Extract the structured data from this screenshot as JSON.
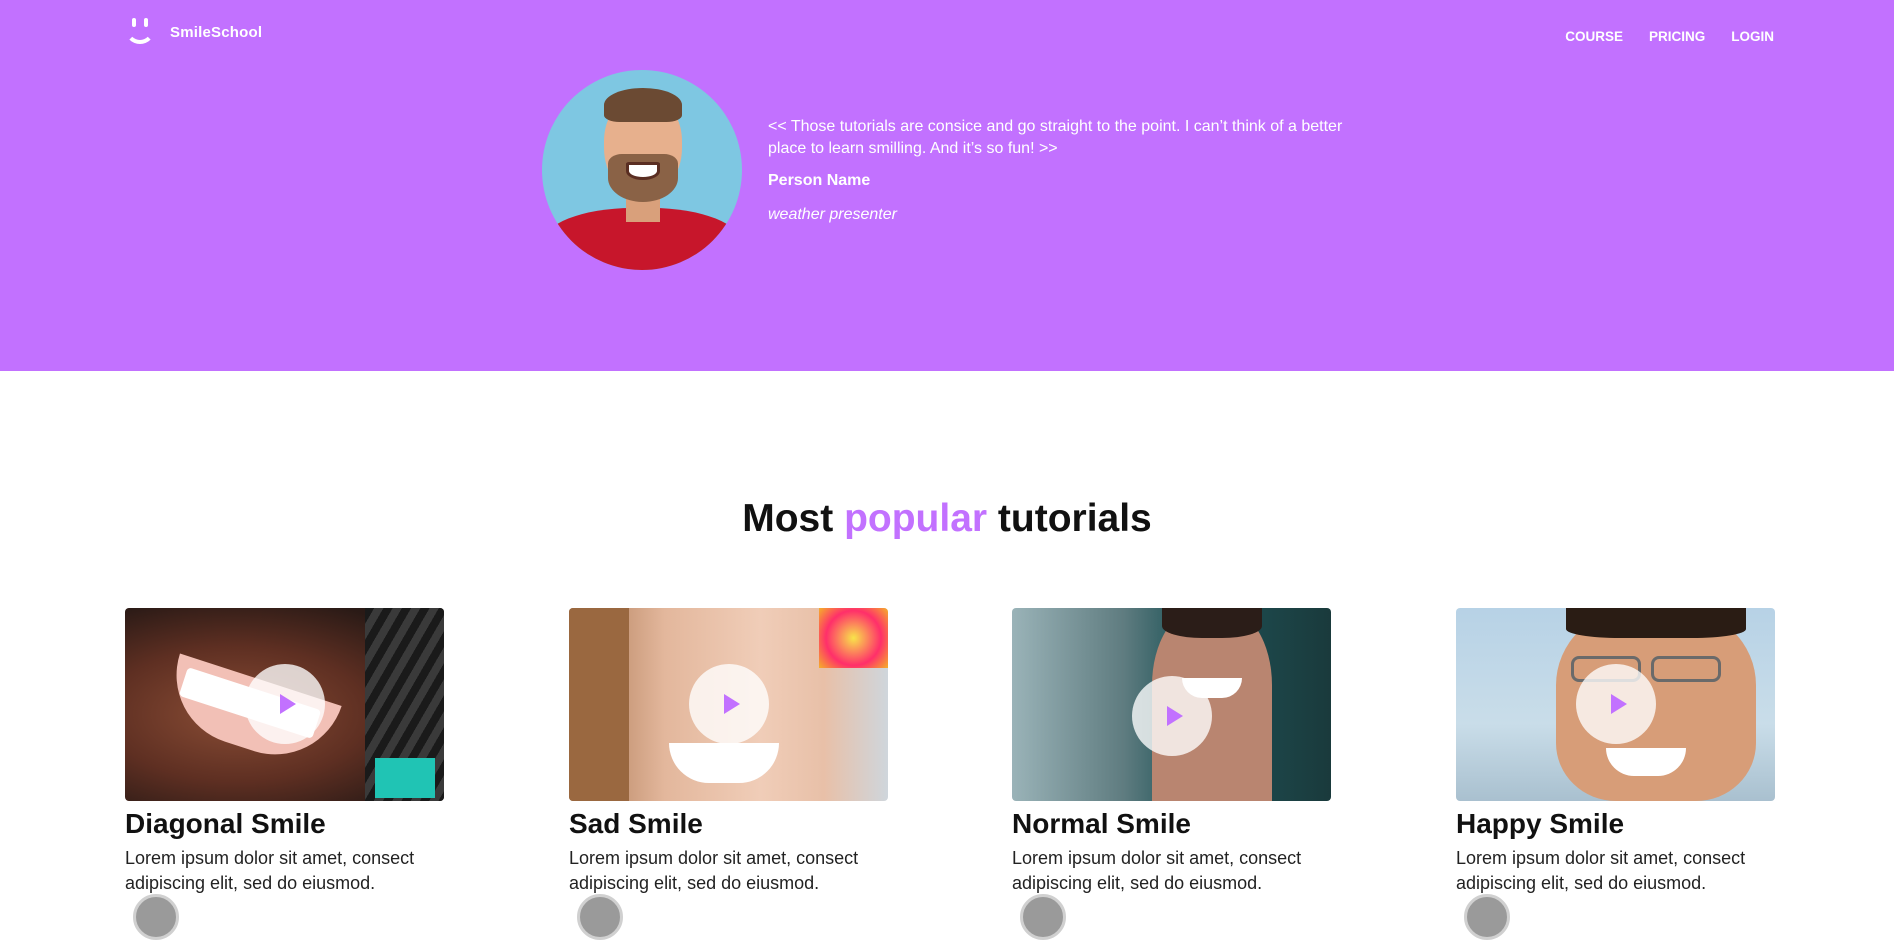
{
  "header": {
    "brand": "SmileSchool",
    "nav": [
      "COURSE",
      "PRICING",
      "LOGIN"
    ]
  },
  "testimonial": {
    "quote": "<< Those tutorials are consice and go straight to the point. I can’t think of a better place to learn smilling. And it’s so fun! >>",
    "name": "Person Name",
    "role": "weather presenter"
  },
  "section": {
    "title_before": "Most ",
    "title_accent": "popular",
    "title_after": " tutorials"
  },
  "cards": [
    {
      "title": "Diagonal Smile",
      "desc": "Lorem ipsum dolor sit amet, consect adipiscing elit, sed do eiusmod."
    },
    {
      "title": "Sad Smile",
      "desc": "Lorem ipsum dolor sit amet, consect adipiscing elit, sed do eiusmod."
    },
    {
      "title": "Normal Smile",
      "desc": "Lorem ipsum dolor sit amet, consect adipiscing elit, sed do eiusmod."
    },
    {
      "title": "Happy Smile",
      "desc": "Lorem ipsum dolor sit amet, consect adipiscing elit, sed do eiusmod."
    }
  ],
  "colors": {
    "brand_purple": "#c271ff"
  }
}
